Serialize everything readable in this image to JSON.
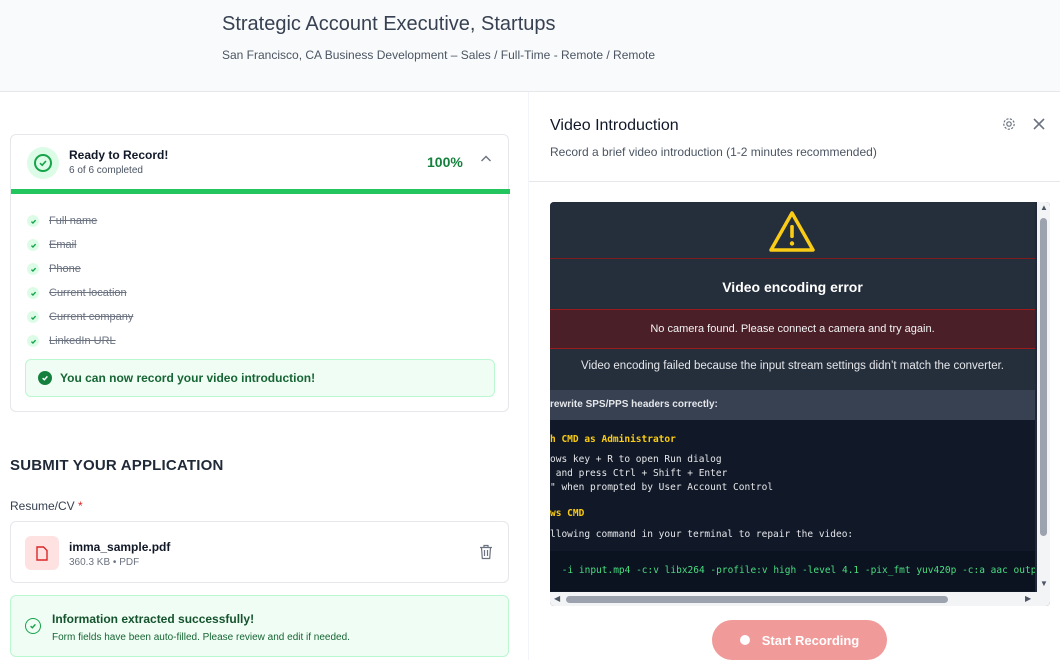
{
  "header": {
    "job_title": "Strategic Account Executive, Startups",
    "meta": "San Francisco, CA  Business Development  –  Sales  /  Full-Time - Remote  /  Remote"
  },
  "progress": {
    "title": "Ready to Record!",
    "subtitle": "6 of 6 completed",
    "percent_label": "100%",
    "percent_value": 100,
    "items": [
      "Full name",
      "Email",
      "Phone",
      "Current location",
      "Current company",
      "LinkedIn URL"
    ],
    "ready_note": "You can now record your video introduction!"
  },
  "application": {
    "section_title": "SUBMIT YOUR APPLICATION",
    "resume_label": "Resume/CV",
    "required_mark": "*",
    "file_name": "imma_sample.pdf",
    "file_meta": "360.3 KB • PDF",
    "extract_title": "Information extracted successfully!",
    "extract_sub": "Form fields have been auto-filled. Please review and edit if needed."
  },
  "video_panel": {
    "title": "Video Introduction",
    "subtitle": "Record a brief video introduction (1-2 minutes recommended)",
    "error_title": "Video encoding error",
    "error_banner": "No camera found. Please connect a camera and try again.",
    "error_desc": "Video encoding failed because the input stream settings didn’t match the converter.",
    "sps_header": "rewrite SPS/PPS headers correctly:",
    "terminal": {
      "step1_title": "h CMD as Administrator",
      "step1_lines": [
        "ows key + R to open Run dialog",
        " and press Ctrl + Shift + Enter",
        "\" when prompted by User Account Control"
      ],
      "step2_title": "ws CMD",
      "step2_line": "llowing command in your terminal to repair the video:",
      "command": " -i input.mp4 -c:v libx264 -profile:v high -level 4.1 -pix_fmt yuv420p -c:a aac output"
    },
    "record_button": "Start Recording"
  },
  "colors": {
    "accent_green": "#16a34a",
    "error_red": "#991b1b",
    "record_button": "#f19a9a"
  }
}
